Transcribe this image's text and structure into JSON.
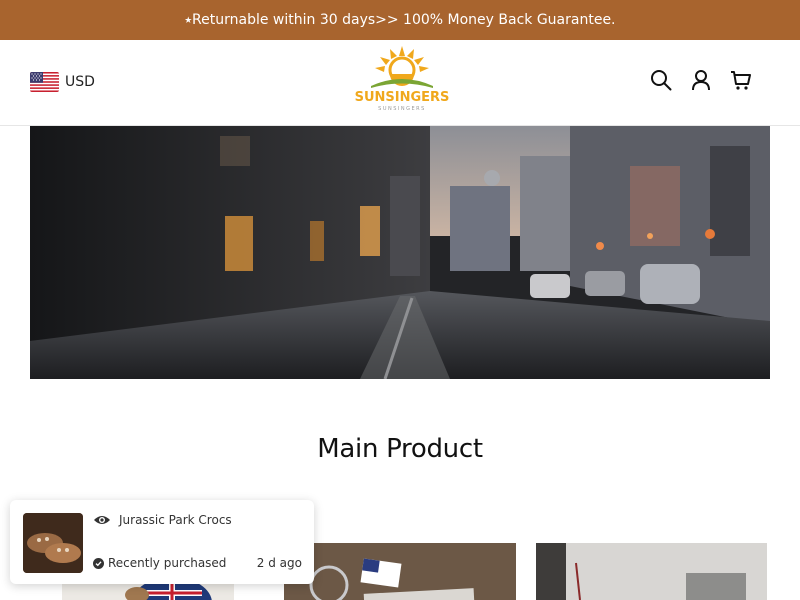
{
  "announcement": {
    "text": "⭑Returnable within 30 days>> 100% Money Back Guarantee."
  },
  "header": {
    "currency": {
      "code": "USD",
      "flag_icon": "us-flag-icon"
    },
    "logo": {
      "name": "SUNSINGERS",
      "tagline": "SUNSINGERS"
    },
    "icons": [
      "search-icon",
      "account-icon",
      "cart-icon"
    ]
  },
  "hero": {
    "description_icon": "city-street-photo"
  },
  "main": {
    "section_title": "Main Product"
  },
  "notification": {
    "product": "Jurassic Park Crocs",
    "status": "Recently purchased",
    "time_ago": "2 d ago"
  },
  "colors": {
    "announcement_bg": "#a8642e",
    "logo_orange": "#f0a81c",
    "logo_green": "#7ba534"
  }
}
